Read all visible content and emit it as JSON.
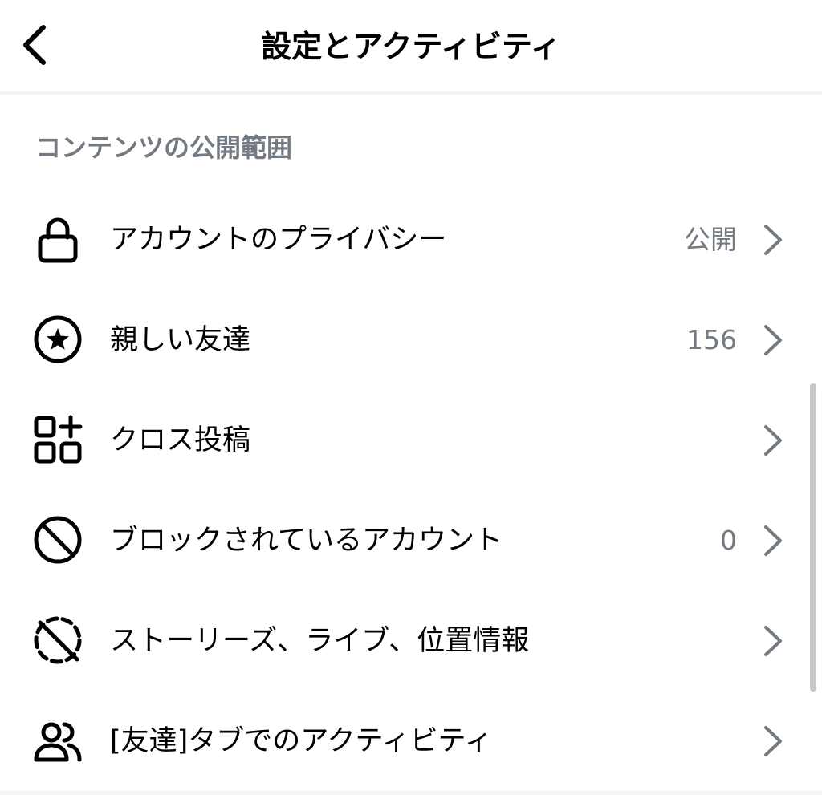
{
  "header": {
    "title": "設定とアクティビティ"
  },
  "section": {
    "title": "コンテンツの公開範囲"
  },
  "items": [
    {
      "label": "アカウントのプライバシー",
      "value": "公開",
      "icon": "lock-icon"
    },
    {
      "label": "親しい友達",
      "value": "156",
      "icon": "star-circle-icon"
    },
    {
      "label": "クロス投稿",
      "value": "",
      "icon": "grid-add-icon"
    },
    {
      "label": "ブロックされているアカウント",
      "value": "0",
      "icon": "block-icon"
    },
    {
      "label": "ストーリーズ、ライブ、位置情報",
      "value": "",
      "icon": "story-off-icon"
    },
    {
      "label": "[友達]タブでのアクティビティ",
      "value": "",
      "icon": "friends-icon"
    }
  ],
  "colors": {
    "text": "#000000",
    "secondary_text": "#737a82",
    "chevron": "#737a82",
    "divider": "#f3f4f5"
  }
}
